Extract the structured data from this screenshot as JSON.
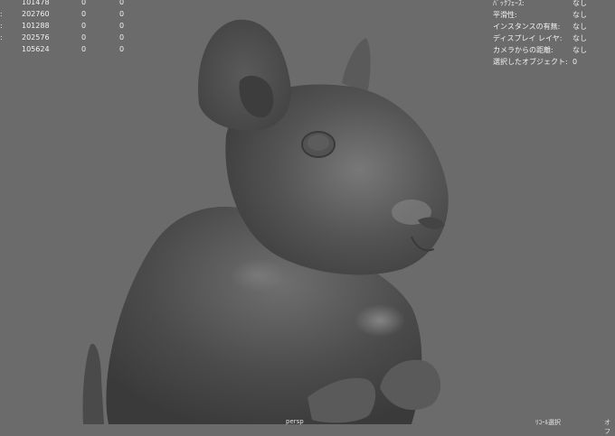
{
  "hud_left": {
    "rows": [
      {
        "edge": "",
        "a": "101478",
        "b": "0",
        "c": "0"
      },
      {
        "edge": ":",
        "a": "202760",
        "b": "0",
        "c": "0"
      },
      {
        "edge": ":",
        "a": "101288",
        "b": "0",
        "c": "0"
      },
      {
        "edge": ":",
        "a": "202576",
        "b": "0",
        "c": "0"
      },
      {
        "edge": "",
        "a": "105624",
        "b": "0",
        "c": "0"
      }
    ]
  },
  "hud_right": {
    "rows": [
      {
        "label": "ﾊﾞｯｸﾌｪｰｽ:",
        "value": "なし"
      },
      {
        "label": "平滑性:",
        "value": "なし"
      },
      {
        "label": "インスタンスの有無:",
        "value": "なし"
      },
      {
        "label": "ディスプレイ レイヤ:",
        "value": "なし"
      },
      {
        "label": "カメラからの距離:",
        "value": "なし"
      },
      {
        "label": "選択したオブジェクト:",
        "value": "0"
      }
    ]
  },
  "footer": {
    "center": "persp",
    "right_label": "ﾘｺｰﾙ選択",
    "right_edge": "オフ"
  },
  "model": {
    "subject": "hamster-sculpt",
    "shade_color": "#4d4d4d",
    "highlight_color": "#8a8a8a",
    "background_color": "#6b6b6b"
  }
}
